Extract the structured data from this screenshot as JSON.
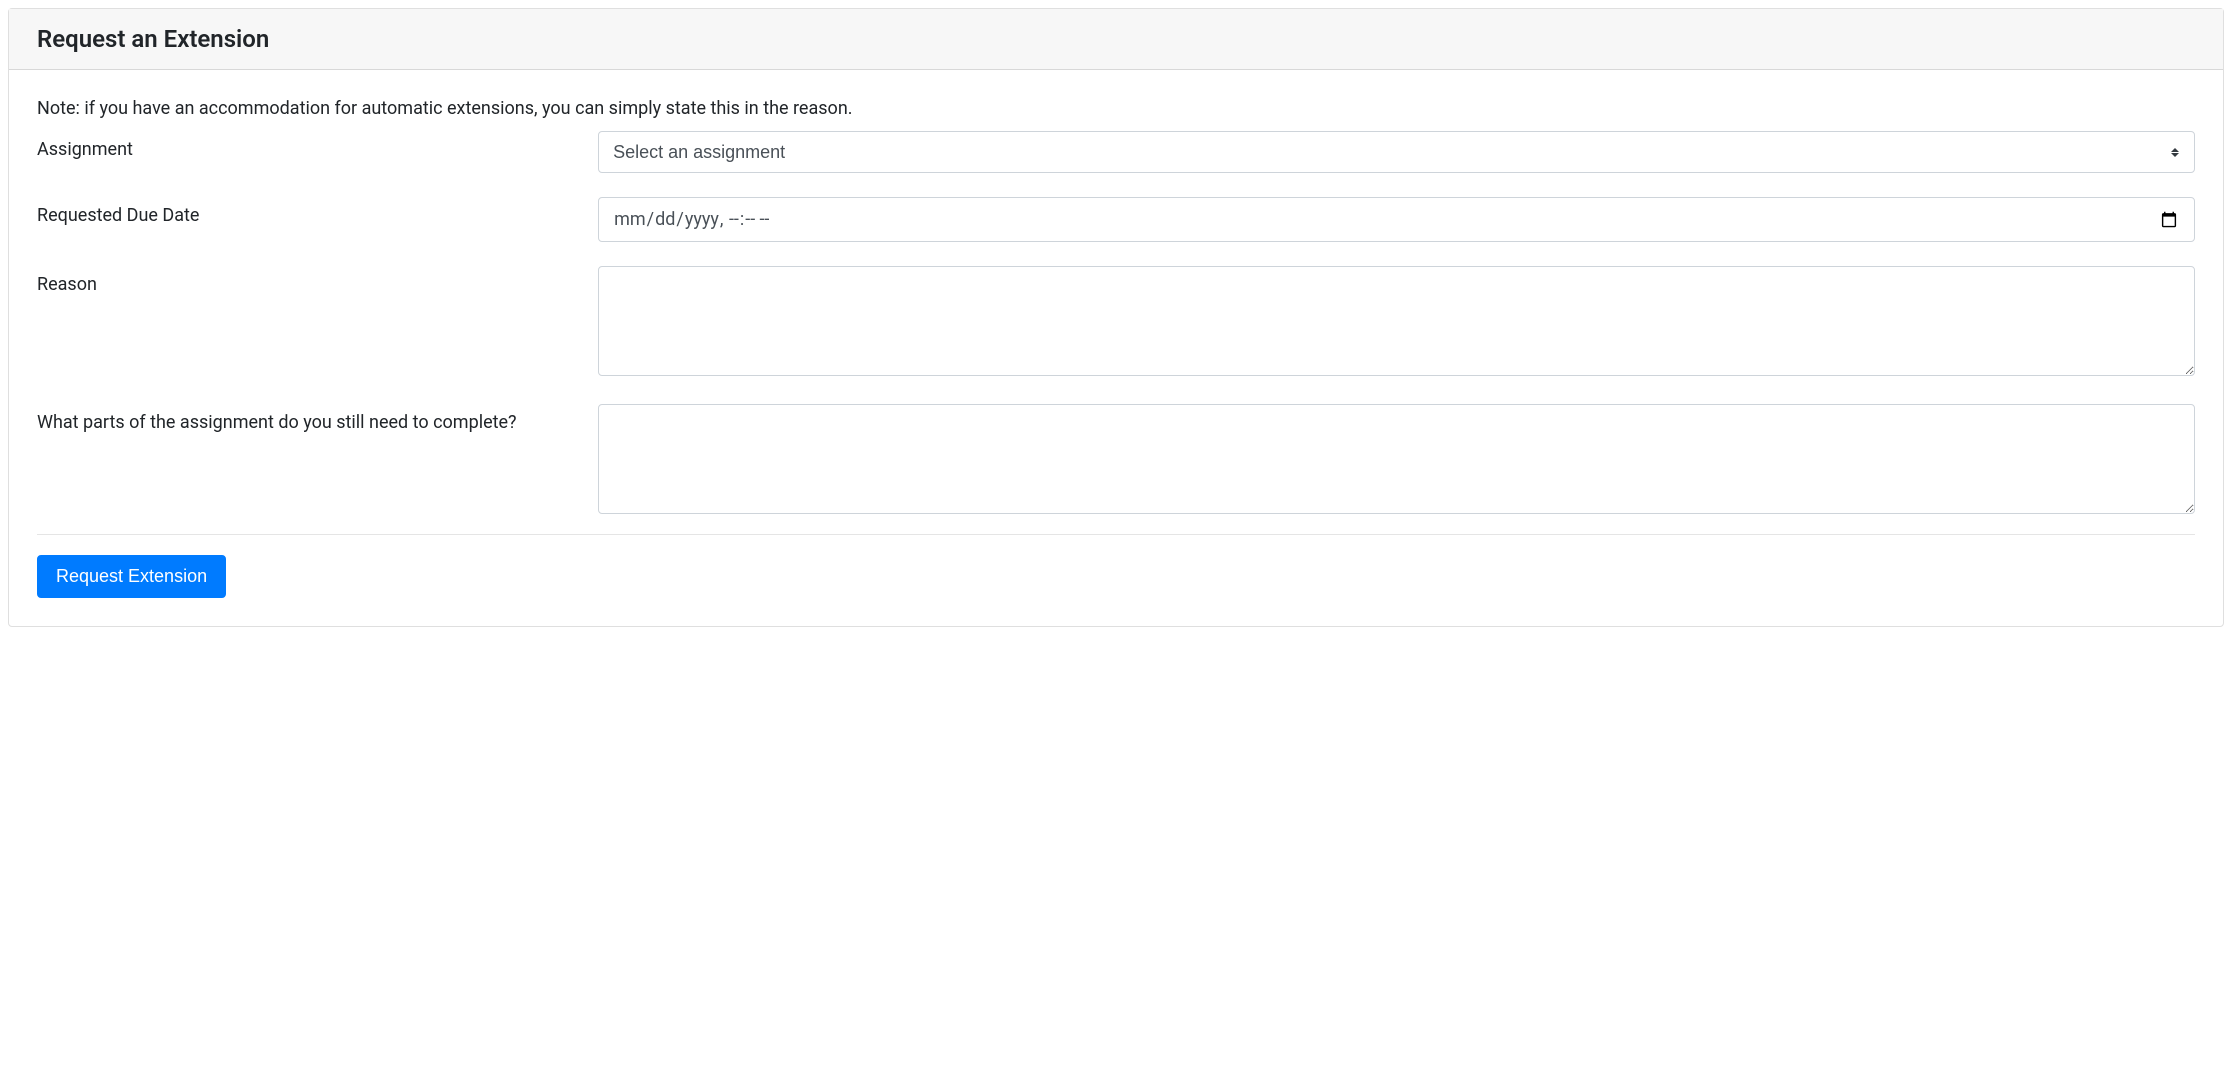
{
  "header": {
    "title": "Request an Extension"
  },
  "note": "Note: if you have an accommodation for automatic extensions, you can simply state this in the reason.",
  "form": {
    "assignment": {
      "label": "Assignment",
      "placeholder_option": "Select an assignment"
    },
    "requested_due_date": {
      "label": "Requested Due Date",
      "placeholder": "mm/dd/yyyy, --:-- --"
    },
    "reason": {
      "label": "Reason",
      "value": ""
    },
    "parts_remaining": {
      "label": "What parts of the assignment do you still need to complete?",
      "value": ""
    },
    "submit_label": "Request Extension"
  }
}
